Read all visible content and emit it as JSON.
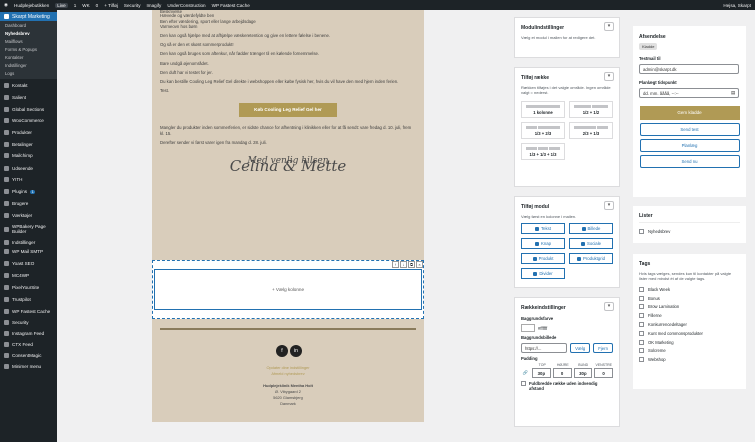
{
  "topbar": {
    "site": "Hudplejebutikken",
    "live": "Live",
    "c1": "1",
    "c2": "WK",
    "c3": "0",
    "new": "+ Tilføj",
    "security": "Security",
    "imagify": "Imagify",
    "construction": "UnderConstruction",
    "cache": "WP Fastest Cache",
    "howdy": "Hejsa, Skarpt"
  },
  "sidebar": {
    "active": "Skarpt Marketing",
    "sub": [
      "Dashboard",
      "Nyhedsbrev",
      "Mailflows",
      "Forms & Popups",
      "Kontakter",
      "Indstillinger",
      "Logs"
    ],
    "menu": [
      {
        "label": "Kontakt",
        "icon": "mail-icon"
      },
      {
        "label": "Salient",
        "icon": "star-icon"
      },
      {
        "label": "Global Sections",
        "icon": "layout-icon"
      },
      {
        "label": "WooCommerce",
        "icon": "cart-icon"
      },
      {
        "label": "Produkter",
        "icon": "box-icon"
      },
      {
        "label": "Betalinger",
        "icon": "card-icon"
      },
      {
        "label": "Mailchimp",
        "icon": "chimp-icon"
      },
      {
        "label": "Udseende",
        "icon": "brush-icon"
      },
      {
        "label": "YITH",
        "icon": "yith-icon"
      },
      {
        "label": "Plugins",
        "icon": "plug-icon",
        "badge": "1"
      },
      {
        "label": "Brugere",
        "icon": "user-icon"
      },
      {
        "label": "Værktøjer",
        "icon": "wrench-icon"
      },
      {
        "label": "WPBakery Page Builder",
        "icon": "builder-icon"
      },
      {
        "label": "Indstillinger",
        "icon": "settings-icon"
      },
      {
        "label": "WP Mail SMTP",
        "icon": "smtp-icon"
      },
      {
        "label": "Yoast SEO",
        "icon": "yoast-icon"
      },
      {
        "label": "MC4WP",
        "icon": "mc4wp-icon"
      },
      {
        "label": "PixelYourSite",
        "icon": "pixel-icon"
      },
      {
        "label": "Trustpilot",
        "icon": "trustpilot-icon"
      },
      {
        "label": "WP Fastest Cache",
        "icon": "cache-icon"
      },
      {
        "label": "Security",
        "icon": "shield-icon"
      },
      {
        "label": "Instagram Feed",
        "icon": "instagram-icon"
      },
      {
        "label": "CTX Feed",
        "icon": "feed-icon"
      },
      {
        "label": "ConsentMagic",
        "icon": "consent-icon"
      },
      {
        "label": "Minimer menu",
        "icon": "collapse-icon"
      }
    ]
  },
  "email": {
    "top_line": "Beskrivelse",
    "p1": [
      "Hævede og værdefyldte ben",
      "Ben efter værdering, sport eller lange arbejdsdage",
      "Varmeovn hos børn"
    ],
    "p2": "Den kan også hjælpe med at afhjælpe væskeretention og give en lettere følelse i benene.",
    "p3": "Og så er den et skønt sommerprodukt!",
    "p4": "Den kan også bruges som aftenkur, når fødder trænger til en kølende fornemmelse.",
    "p5": "Bare undgå øjenområdet.",
    "p6": "Den duft har vi testet for jer.",
    "p7": "Du kan bestille Cooling Leg Relief Gel direkte i webshoppen eller købe fysisk her, hvis du vil have den med hjem inden ferien.",
    "p8": "Test.",
    "cta": "Køb Cooling Leg Relief Gel her",
    "p9": "Mangler du produkter inden sommerferien, er sidste chance for afhentning i klinikken eller for at få sendt: vare fredag d. 10. juli, frem kl. 15.",
    "p10": "Derefter sender vi først varer igen fra mandag d. 28. juli.",
    "sig_line1": "Med venlig hilsen",
    "sig_line2": "Celina & Mette",
    "add_column": "+ Vælg kolonne",
    "unsub1": "Opdater dine indstillinger",
    "unsub2": "Afmeld nyhedsbrev",
    "company": "Hudplejeklinik Mentha Holt",
    "street": "Ø. Vibygaard 2",
    "city": "5620 Glamsbjerg",
    "country": "Danmark",
    "social": [
      "f",
      "in"
    ]
  },
  "mod_settings": {
    "title": "Modulindstillinger",
    "desc": "Vælg et modul i mailen for at redigere det."
  },
  "add_row": {
    "title": "Tilføj række",
    "desc": "Rækken tilføjes i det valgte område. Ingen område valgt = nederst.",
    "layouts": [
      {
        "label": "1 kolonne",
        "cols": 1
      },
      {
        "label": "1/2 + 1/2",
        "cols": 2
      },
      {
        "label": "1/3 + 2/3",
        "cols": 2
      },
      {
        "label": "2/3 + 1/3",
        "cols": 2
      },
      {
        "label": "1/3 + 1/3 + 1/3",
        "cols": 3
      }
    ]
  },
  "add_module": {
    "title": "Tilføj modul",
    "desc": "Vælg først en kolonne i mailen.",
    "modules": [
      {
        "label": "Tekst",
        "icon": "text-icon"
      },
      {
        "label": "Billede",
        "icon": "image-icon"
      },
      {
        "label": "Knap",
        "icon": "link-icon"
      },
      {
        "label": "Sociale",
        "icon": "share-icon"
      },
      {
        "label": "Produkt",
        "icon": "product-icon"
      },
      {
        "label": "Produktgrid",
        "icon": "grid-icon"
      },
      {
        "label": "Divider",
        "icon": "minus-icon"
      }
    ]
  },
  "row_settings": {
    "title": "Rækkeindstillinger",
    "bg_color_label": "Baggrundsfarve",
    "bg_color": "#ffffff",
    "bg_image_label": "Baggrundsbillede",
    "bg_image_placeholder": "https://...",
    "choose": "Vælg",
    "remove": "Fjern",
    "padding_label": "Padding",
    "padding_cols": [
      "TOP",
      "HØJRE",
      "BUND",
      "VENSTRE"
    ],
    "padding_vals": [
      "30p",
      "0",
      "30p",
      "0"
    ],
    "full_width": "Fuldbredde række uden indvendig afstand"
  },
  "sender": {
    "title": "Afsendelse",
    "status": "Kladde",
    "test_label": "Testmail til",
    "test_email": "admin@skarpt.dk",
    "schedule_label": "Planlægt tidspunkt",
    "schedule_placeholder": "dd. mm. åååå, --:--",
    "save": "Gem kladde",
    "send_test": "Send test",
    "schedule": "Planlæg",
    "send_now": "Send nu"
  },
  "lists": {
    "title": "Lister",
    "items": [
      "Nyhedsbrev"
    ]
  },
  "tags": {
    "title": "Tags",
    "desc": "Hvis tags vælges, sendes kun til kontakter på valgte lister med mindst ét af de valgte tags.",
    "items": [
      "Black Week",
      "Bonus",
      "Brow Lamination",
      "Fillerne",
      "Konkurrencedeltager",
      "Kunt med commonsprodukter",
      "OK Marketing",
      "Solcreme",
      "Webshop"
    ]
  }
}
